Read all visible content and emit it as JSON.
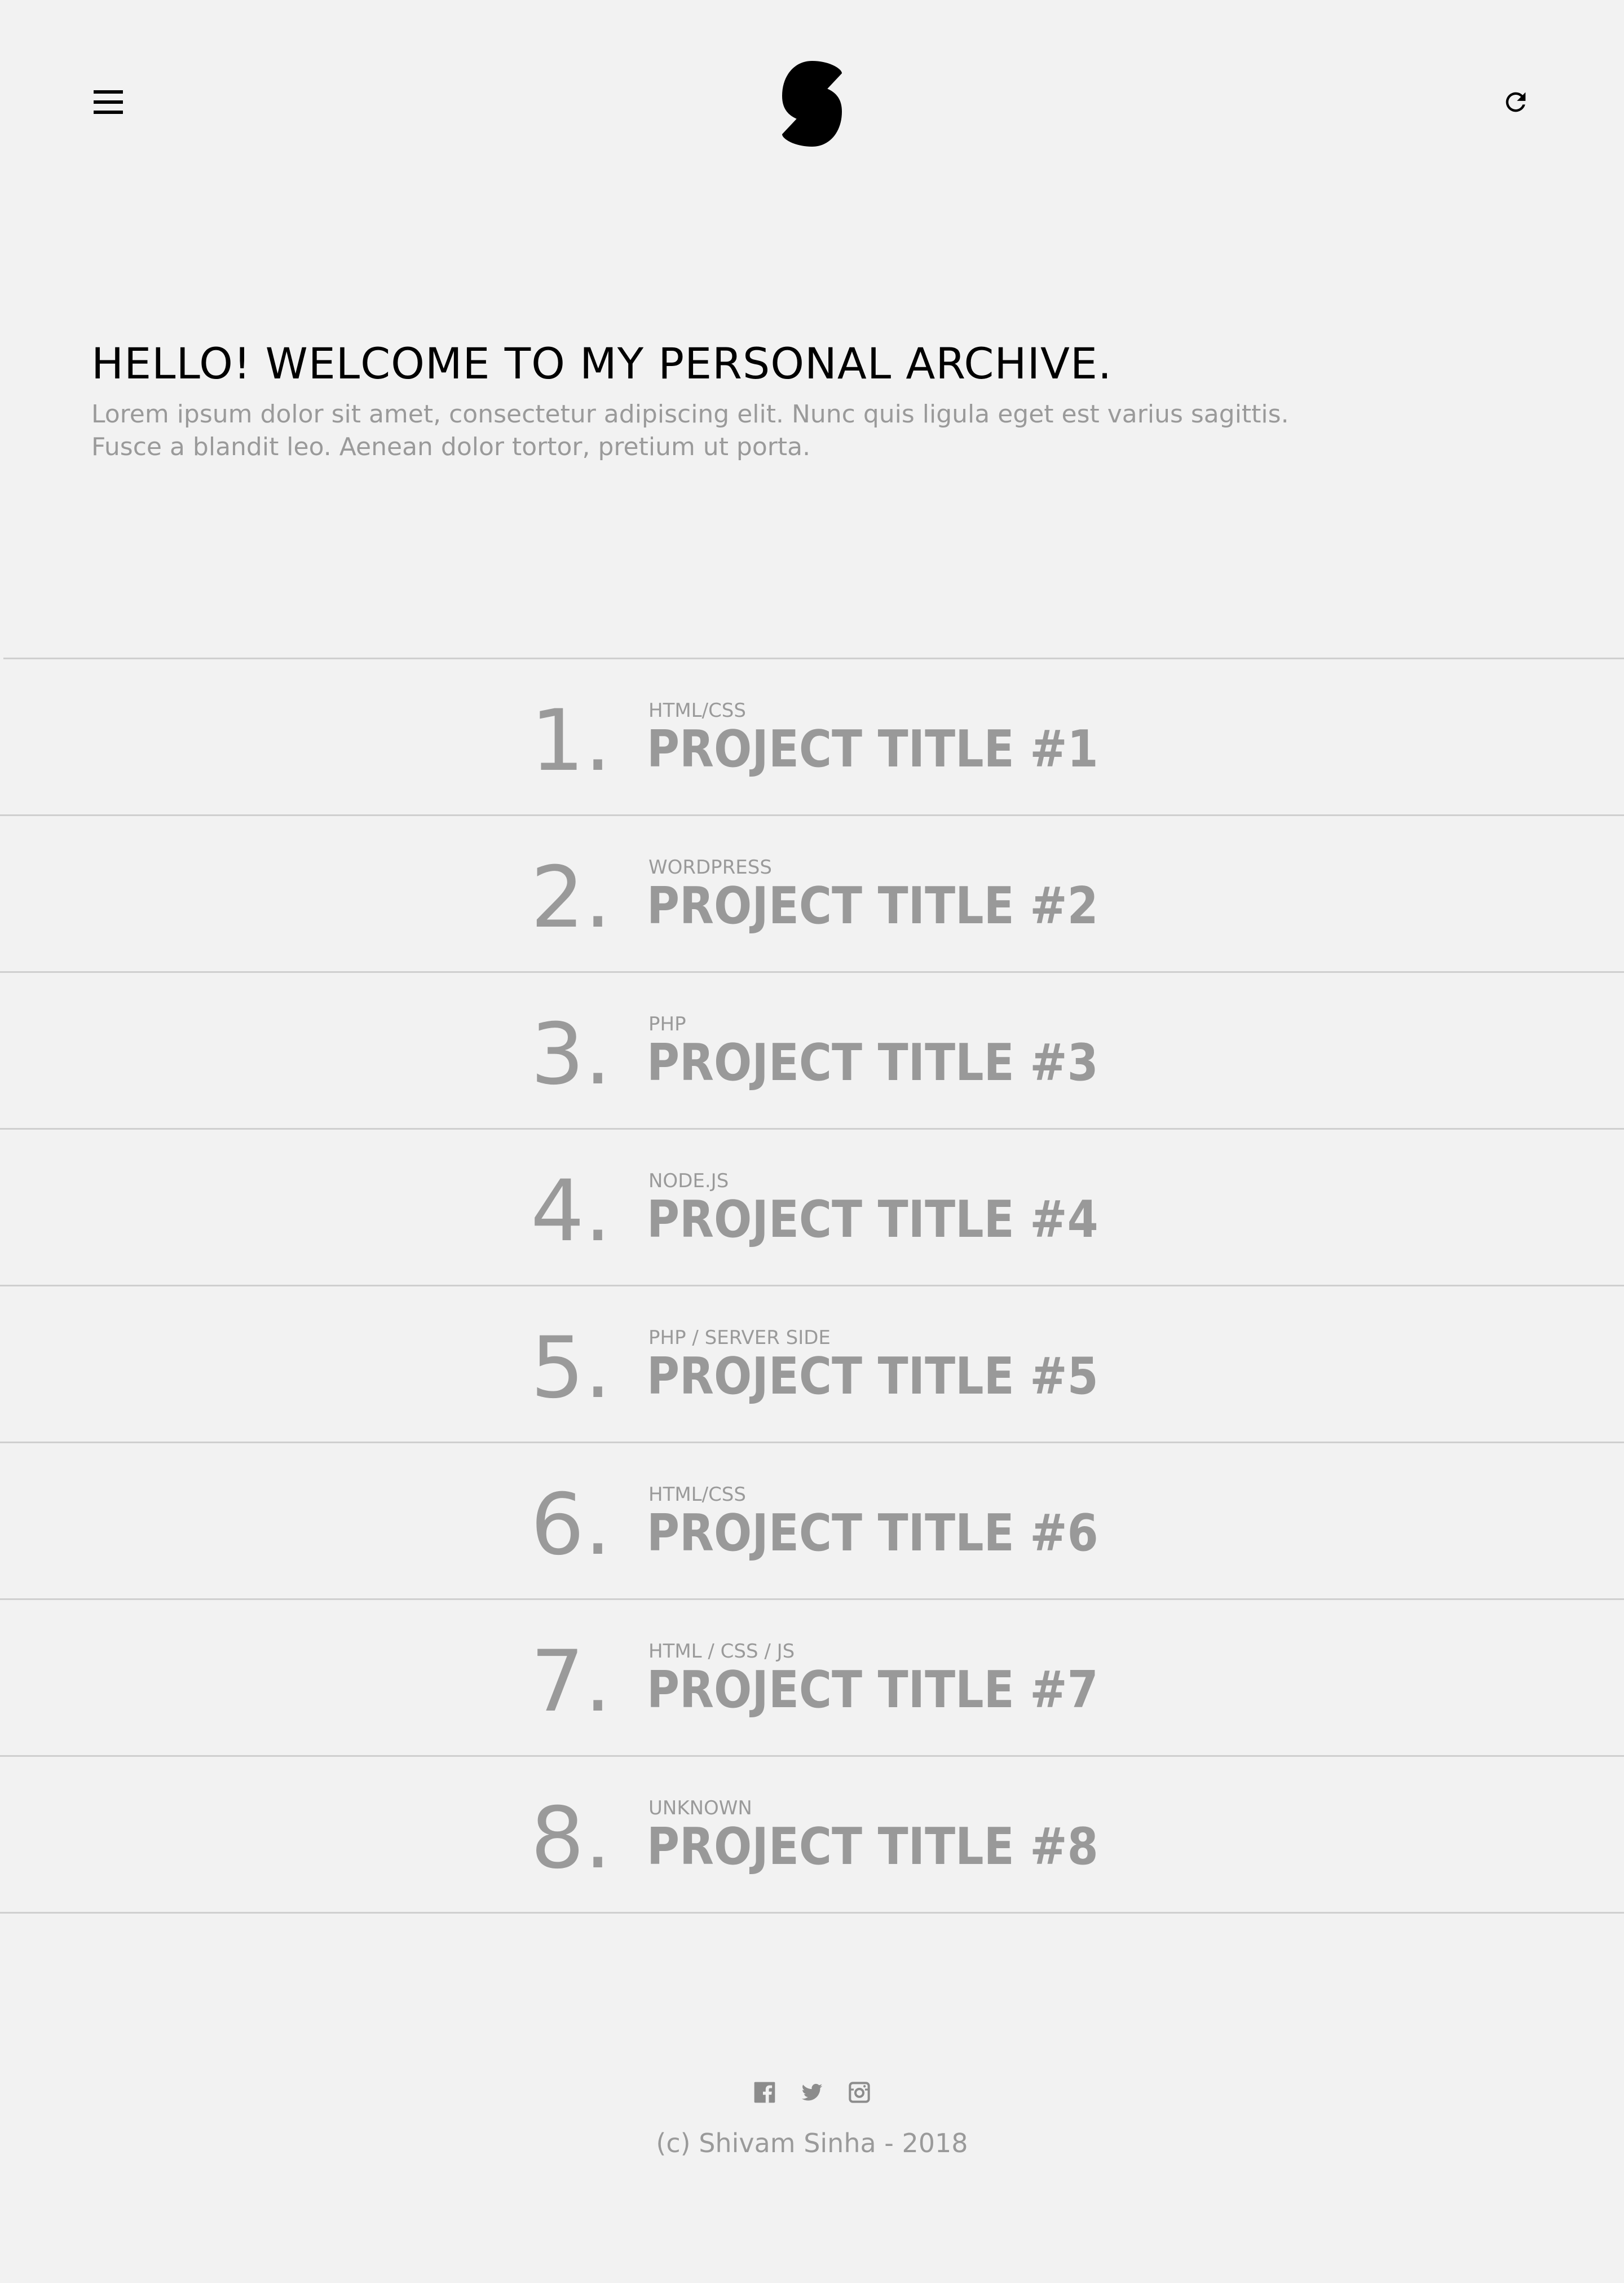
{
  "header": {
    "menu_icon": "hamburger-menu-icon",
    "logo_icon": "s-logo-mark",
    "refresh_icon": "refresh-icon"
  },
  "intro": {
    "heading": "HELLO! WELCOME TO MY PERSONAL ARCHIVE.",
    "lines": [
      "Lorem ipsum dolor sit amet, consectetur adipiscing elit. Nunc quis ligula eget est varius sagittis.",
      "Fusce a blandit leo. Aenean dolor tortor, pretium ut porta."
    ]
  },
  "projects": [
    {
      "number": "1.",
      "tag": "HTML/CSS",
      "title": "PROJECT TITLE #1"
    },
    {
      "number": "2.",
      "tag": "WORDPRESS",
      "title": "PROJECT TITLE #2"
    },
    {
      "number": "3.",
      "tag": "PHP",
      "title": "PROJECT TITLE #3"
    },
    {
      "number": "4.",
      "tag": "NODE.JS",
      "title": "PROJECT TITLE #4"
    },
    {
      "number": "5.",
      "tag": "PHP / SERVER SIDE",
      "title": "PROJECT TITLE #5"
    },
    {
      "number": "6.",
      "tag": "HTML/CSS",
      "title": "PROJECT TITLE #6"
    },
    {
      "number": "7.",
      "tag": "HTML / CSS / JS",
      "title": "PROJECT TITLE #7"
    },
    {
      "number": "8.",
      "tag": "UNKNOWN",
      "title": "PROJECT TITLE #8"
    }
  ],
  "footer": {
    "socials": [
      "facebook-icon",
      "twitter-icon",
      "instagram-icon"
    ],
    "copyright": "(c) Shivam Sinha - 2018"
  },
  "colors": {
    "background": "#f2f2f2",
    "text_dark": "#000000",
    "text_muted": "#9a9a9a",
    "divider": "#cfcfcf"
  }
}
